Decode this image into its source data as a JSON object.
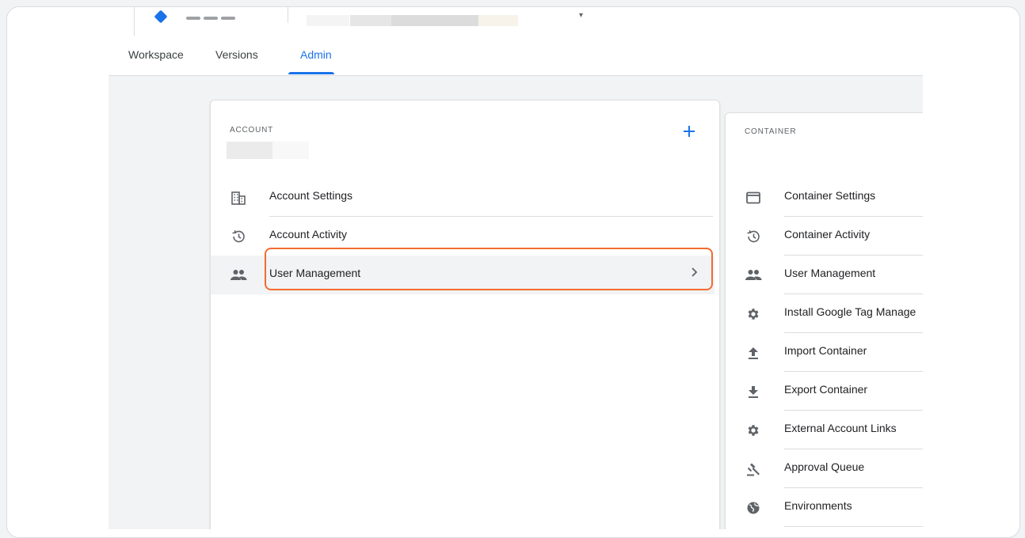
{
  "colors": {
    "accent": "#1a73e8",
    "highlight": "#f26b2f"
  },
  "tabs": [
    {
      "label": "Workspace",
      "active": false
    },
    {
      "label": "Versions",
      "active": false
    },
    {
      "label": "Admin",
      "active": true
    }
  ],
  "account": {
    "section_label": "ACCOUNT",
    "add_icon": "plus-icon",
    "items": [
      {
        "label": "Account Settings",
        "icon": "building-icon"
      },
      {
        "label": "Account Activity",
        "icon": "history-icon"
      },
      {
        "label": "User Management",
        "icon": "people-icon",
        "highlighted": true,
        "chevron": "chevron-right-icon"
      }
    ]
  },
  "container": {
    "section_label": "CONTAINER",
    "items": [
      {
        "label": "Container Settings",
        "icon": "web-asset-icon"
      },
      {
        "label": "Container Activity",
        "icon": "history-icon"
      },
      {
        "label": "User Management",
        "icon": "people-icon"
      },
      {
        "label": "Install Google Tag Manage",
        "icon": "gear-icon"
      },
      {
        "label": "Import Container",
        "icon": "upload-icon"
      },
      {
        "label": "Export Container",
        "icon": "download-icon"
      },
      {
        "label": "External Account Links",
        "icon": "gear-icon"
      },
      {
        "label": "Approval Queue",
        "icon": "gavel-icon"
      },
      {
        "label": "Environments",
        "icon": "globe-icon"
      }
    ]
  }
}
